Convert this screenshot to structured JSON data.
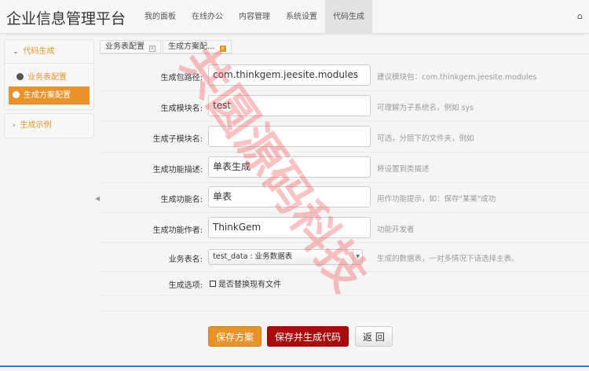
{
  "header": {
    "brand": "企业信息管理平台",
    "nav": [
      "我的面板",
      "在线办公",
      "内容管理",
      "系统设置",
      "代码生成"
    ],
    "home_icon": "⌂"
  },
  "sidebar": {
    "group1": "代码生成",
    "items": [
      "业务表配置",
      "生成方案配置"
    ],
    "group2": "生成示例"
  },
  "tabs": [
    "业务表配置",
    "生成方案配..."
  ],
  "form": [
    {
      "label": "生成包路径:",
      "value": "com.thinkgem.jeesite.modules",
      "hint": "建议模块包：com.thinkgem.jeesite.modules"
    },
    {
      "label": "生成模块名:",
      "value": "test",
      "hint": "可理解为子系统名，例如 sys"
    },
    {
      "label": "生成子模块名:",
      "value": "",
      "hint": "可选，分层下的文件夹，例如"
    },
    {
      "label": "生成功能描述:",
      "value": "单表生成",
      "hint": "将设置到类描述"
    },
    {
      "label": "生成功能名:",
      "value": "单表",
      "hint": "用作功能提示，如：保存\"某某\"成功"
    },
    {
      "label": "生成功能作者:",
      "value": "ThinkGem",
      "hint": "功能开发者"
    }
  ],
  "table": {
    "label": "业务表名:",
    "value": "test_data : 业务数据表",
    "hint": "生成的数据表，一对多情况下请选择主表。"
  },
  "options": {
    "label": "生成选项:",
    "checkbox": "是否替换现有文件"
  },
  "buttons": {
    "save": "保存方案",
    "save_gen": "保存并生成代码",
    "back": "返 回"
  },
  "watermark": "共圆源码科技"
}
